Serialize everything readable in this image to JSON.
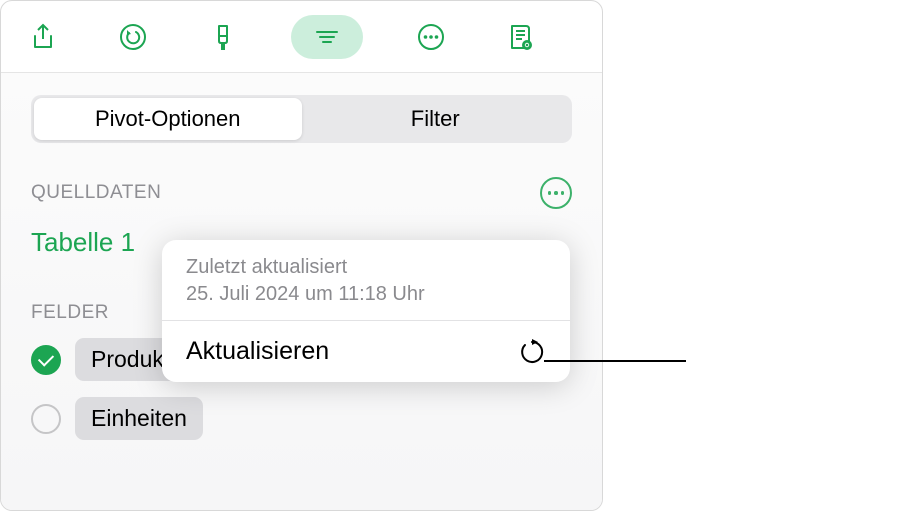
{
  "toolbar": {
    "icons": [
      "share",
      "undo",
      "format-brush",
      "filter-list",
      "more-ellipsis",
      "activity"
    ]
  },
  "segments": {
    "pivot": "Pivot-Optionen",
    "filter": "Filter"
  },
  "sourceData": {
    "header": "QUELLDATEN",
    "tableName": "Tabelle 1"
  },
  "fields": {
    "header": "FELDER",
    "items": [
      {
        "label": "Produkt",
        "checked": true
      },
      {
        "label": "Einheiten",
        "checked": false
      }
    ]
  },
  "popover": {
    "lastUpdatedLabel": "Zuletzt aktualisiert",
    "lastUpdatedValue": "25. Juli 2024 um 11:18 Uhr",
    "refreshLabel": "Aktualisieren"
  }
}
